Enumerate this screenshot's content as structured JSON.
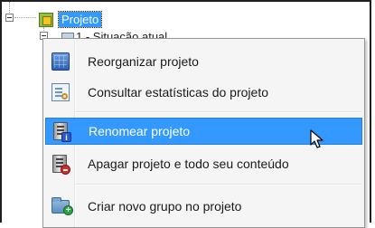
{
  "tree": {
    "root_label": "Projeto",
    "child_label": "1 - Situação atual"
  },
  "context_menu": {
    "items": [
      {
        "id": "reorganize",
        "label": "Reorganizar projeto",
        "icon": "cube-grid-icon"
      },
      {
        "id": "stats",
        "label": "Consultar estatísticas do projeto",
        "icon": "statistics-icon"
      },
      {
        "id": "rename",
        "label": "Renomear projeto",
        "icon": "server-rename-icon",
        "highlighted": true
      },
      {
        "id": "delete",
        "label": "Apagar projeto e todo seu conteúdo",
        "icon": "server-delete-icon"
      },
      {
        "id": "new_group",
        "label": "Criar novo grupo no projeto",
        "icon": "folder-add-icon"
      }
    ]
  },
  "colors": {
    "highlight": "#3399ff",
    "menu_background": "#f5f5f5",
    "menu_border": "#979797"
  }
}
